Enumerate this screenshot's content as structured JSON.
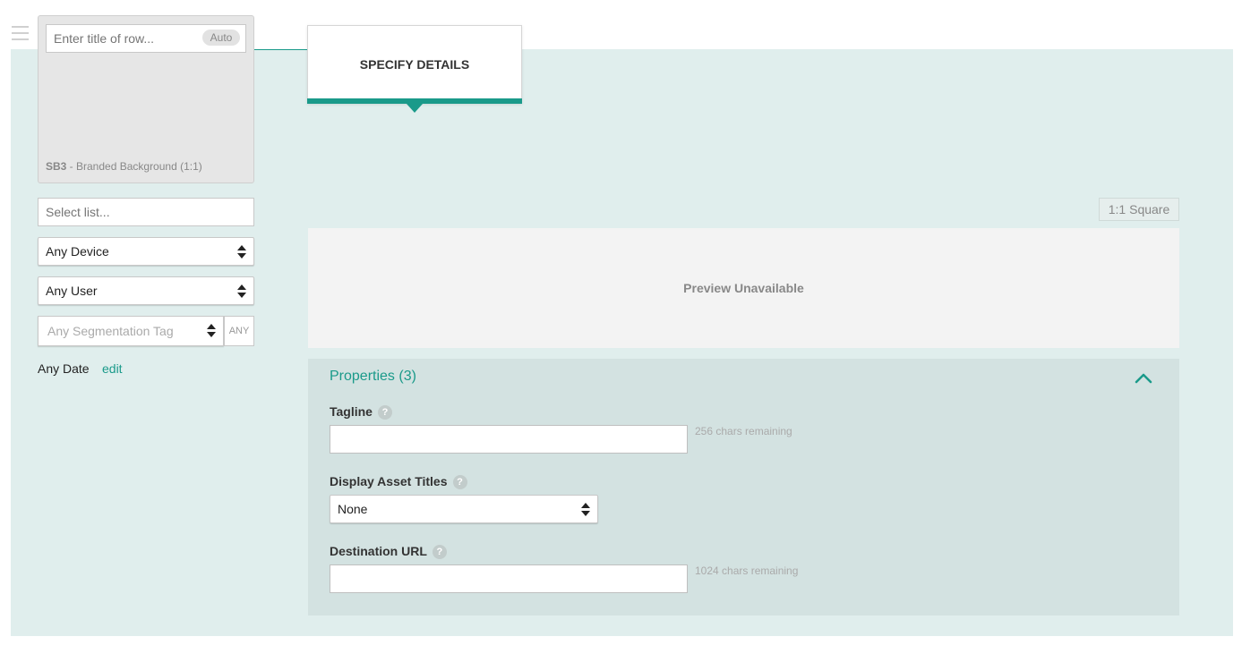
{
  "row_card": {
    "title_placeholder": "Enter title of row...",
    "auto_label": "Auto",
    "caption_code": "SB3",
    "caption_text": " - Branded Background (1:1)"
  },
  "filters": {
    "list_placeholder": "Select list...",
    "device_value": "Any Device",
    "user_value": "Any User",
    "segmentation_placeholder": "Any Segmentation Tag",
    "any_button": "ANY",
    "date_label": "Any Date",
    "edit_link": "edit"
  },
  "tab": {
    "label": "SPECIFY DETAILS"
  },
  "preview": {
    "aspect_label": "1:1 Square",
    "message": "Preview Unavailable"
  },
  "properties": {
    "title": "Properties (3)",
    "help_glyph": "?",
    "tagline": {
      "label": "Tagline",
      "value": "",
      "remaining": "256 chars remaining"
    },
    "display_asset_titles": {
      "label": "Display Asset Titles",
      "value": "None"
    },
    "destination_url": {
      "label": "Destination URL",
      "value": "",
      "remaining": "1024 chars remaining"
    }
  },
  "colors": {
    "accent": "#1a9a8a",
    "background": "#e0eeed",
    "panel": "#d3e2e1"
  }
}
